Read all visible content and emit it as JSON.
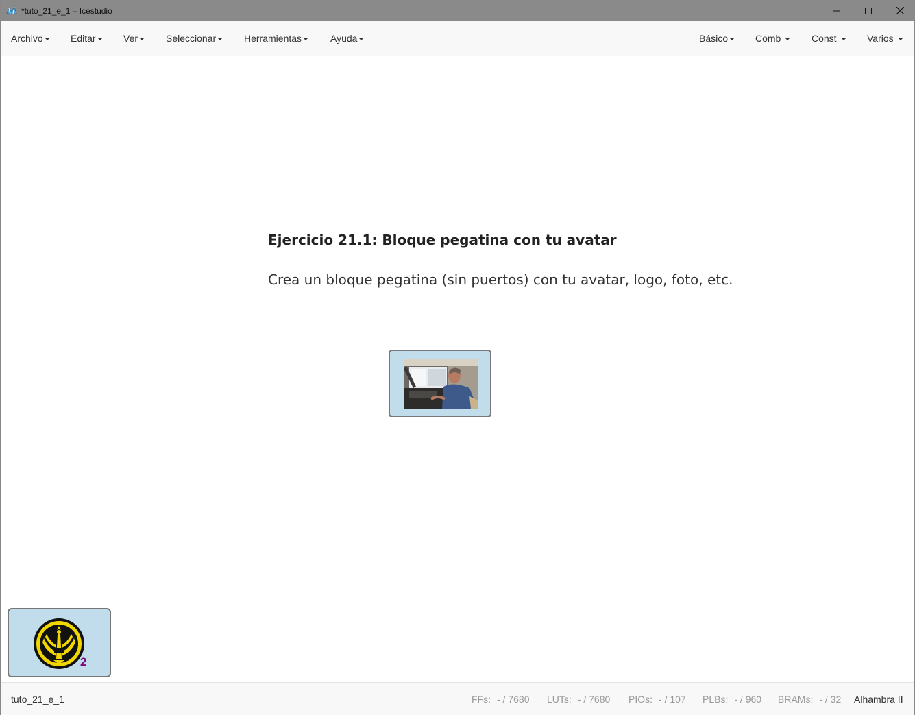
{
  "window": {
    "title": "*tuto_21_e_1 – Icestudio",
    "icon": "icestudio-app-icon",
    "controls": [
      "minimize-icon",
      "maximize-icon",
      "close-icon"
    ]
  },
  "menu": {
    "left": [
      {
        "label": "Archivo"
      },
      {
        "label": "Editar"
      },
      {
        "label": "Ver"
      },
      {
        "label": "Seleccionar"
      },
      {
        "label": "Herramientas"
      },
      {
        "label": "Ayuda"
      }
    ],
    "right": [
      {
        "label": "Básico"
      },
      {
        "label": "Comb"
      },
      {
        "label": "Const"
      },
      {
        "label": "Varios"
      }
    ]
  },
  "canvas": {
    "info_title": "Ejercicio 21.1: Bloque pegatina con tu avatar",
    "info_body": "Crea un bloque pegatina (sin puertos) con tu avatar, logo, foto, etc.",
    "image_block": {
      "content": "photo of a man in a cockpit"
    },
    "collection_block": {
      "icon": "fpga-wars-logo-icon",
      "count": "2"
    }
  },
  "footer": {
    "project_name": "tuto_21_e_1",
    "stats": [
      {
        "label": "FFs:",
        "value": "- / 7680"
      },
      {
        "label": "LUTs:",
        "value": "- / 7680"
      },
      {
        "label": "PIOs:",
        "value": "- / 107"
      },
      {
        "label": "PLBs:",
        "value": "- / 960"
      },
      {
        "label": "BRAMs:",
        "value": "- / 32"
      }
    ],
    "board": "Alhambra II"
  },
  "colors": {
    "titlebar": "#8a8a8a",
    "menubar": "#f8f8f8",
    "block_fill": "#c1dcea",
    "block_border": "#777777",
    "badge_count": "#800080"
  }
}
